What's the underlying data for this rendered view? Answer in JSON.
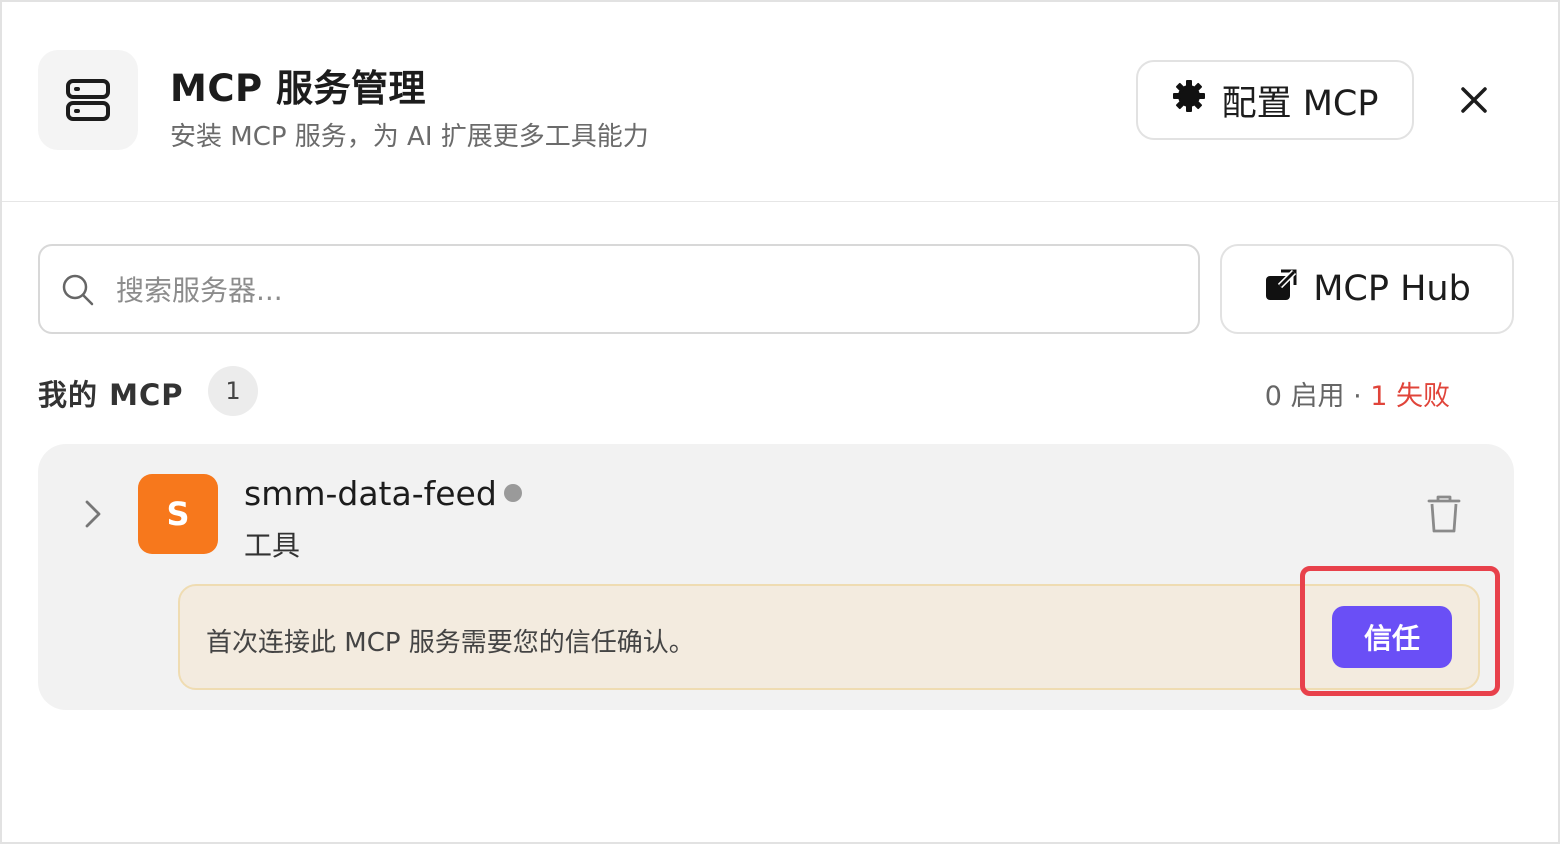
{
  "header": {
    "icon": "server-stack-icon",
    "title": "MCP 服务管理",
    "subtitle": "安装 MCP 服务，为 AI 扩展更多工具能力",
    "config_button": {
      "icon": "gear-icon",
      "label": "配置 MCP"
    },
    "close_icon": "close-icon"
  },
  "search": {
    "icon": "search-icon",
    "placeholder": "搜索服务器..."
  },
  "hub_button": {
    "icon": "external-link-icon",
    "label": "MCP Hub"
  },
  "section": {
    "title": "我的 MCP",
    "count": "1",
    "stats_enabled": "0 启用",
    "stats_separator": " · ",
    "stats_failed": "1 失败"
  },
  "servers": [
    {
      "avatar_letter": "S",
      "name": "smm-data-feed",
      "type": "工具",
      "status": "inactive",
      "trust_message": "首次连接此 MCP 服务需要您的信任确认。",
      "trust_button": "信任"
    }
  ],
  "colors": {
    "accent": "#6a4ff6",
    "avatar": "#f7781c",
    "failed": "#e0443a",
    "banner_bg": "#f3ebdf",
    "highlight": "#e8414b"
  }
}
